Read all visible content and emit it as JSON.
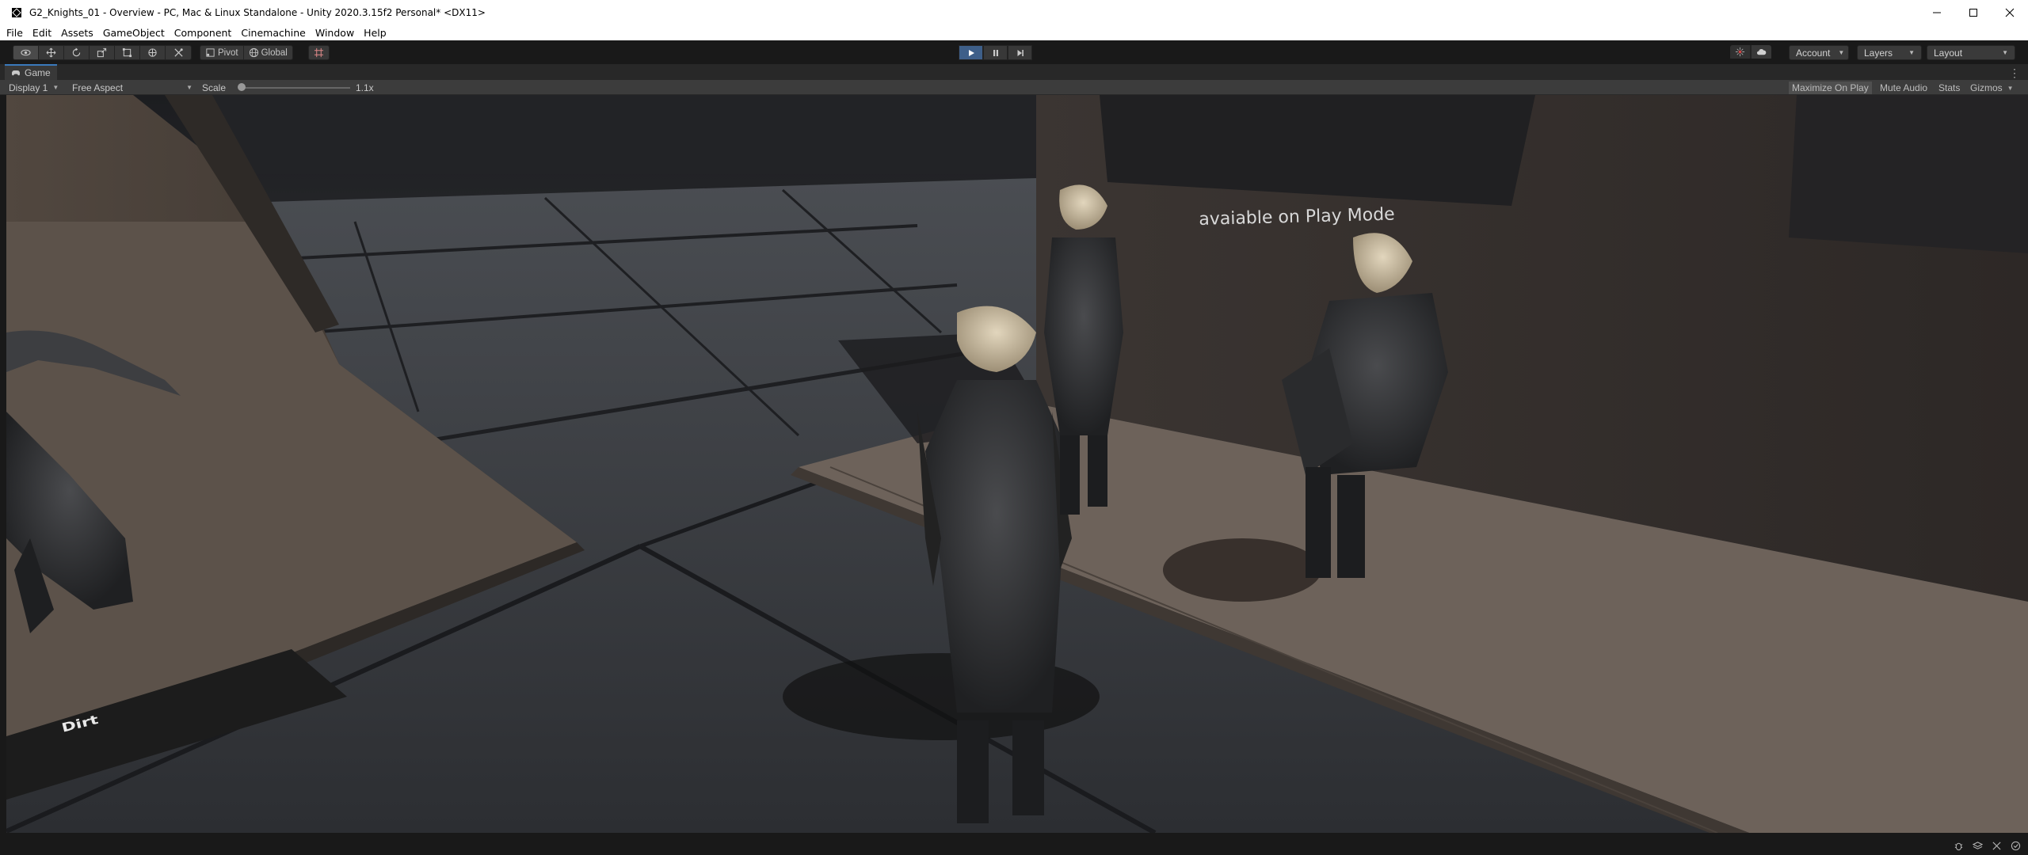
{
  "window": {
    "title": "G2_Knights_01 - Overview - PC, Mac & Linux Standalone - Unity 2020.3.15f2 Personal* <DX11>"
  },
  "menu": [
    "File",
    "Edit",
    "Assets",
    "GameObject",
    "Component",
    "Cinemachine",
    "Window",
    "Help"
  ],
  "toolbar": {
    "pivot_label": "Pivot",
    "global_label": "Global",
    "account_label": "Account",
    "layers_label": "Layers",
    "layout_label": "Layout"
  },
  "tab": {
    "label": "Game"
  },
  "game_toolbar": {
    "display": "Display 1",
    "aspect": "Free Aspect",
    "scale_label": "Scale",
    "scale_value": "1.1x",
    "maximize": "Maximize On Play",
    "mute": "Mute Audio",
    "stats": "Stats",
    "gizmos": "Gizmos"
  },
  "scene": {
    "wall_sign": "avaiable on Play Mode",
    "floor_sign": "Dirt"
  },
  "colors": {
    "play_active": "#3e5f89",
    "tab_accent": "#3a79bb"
  }
}
